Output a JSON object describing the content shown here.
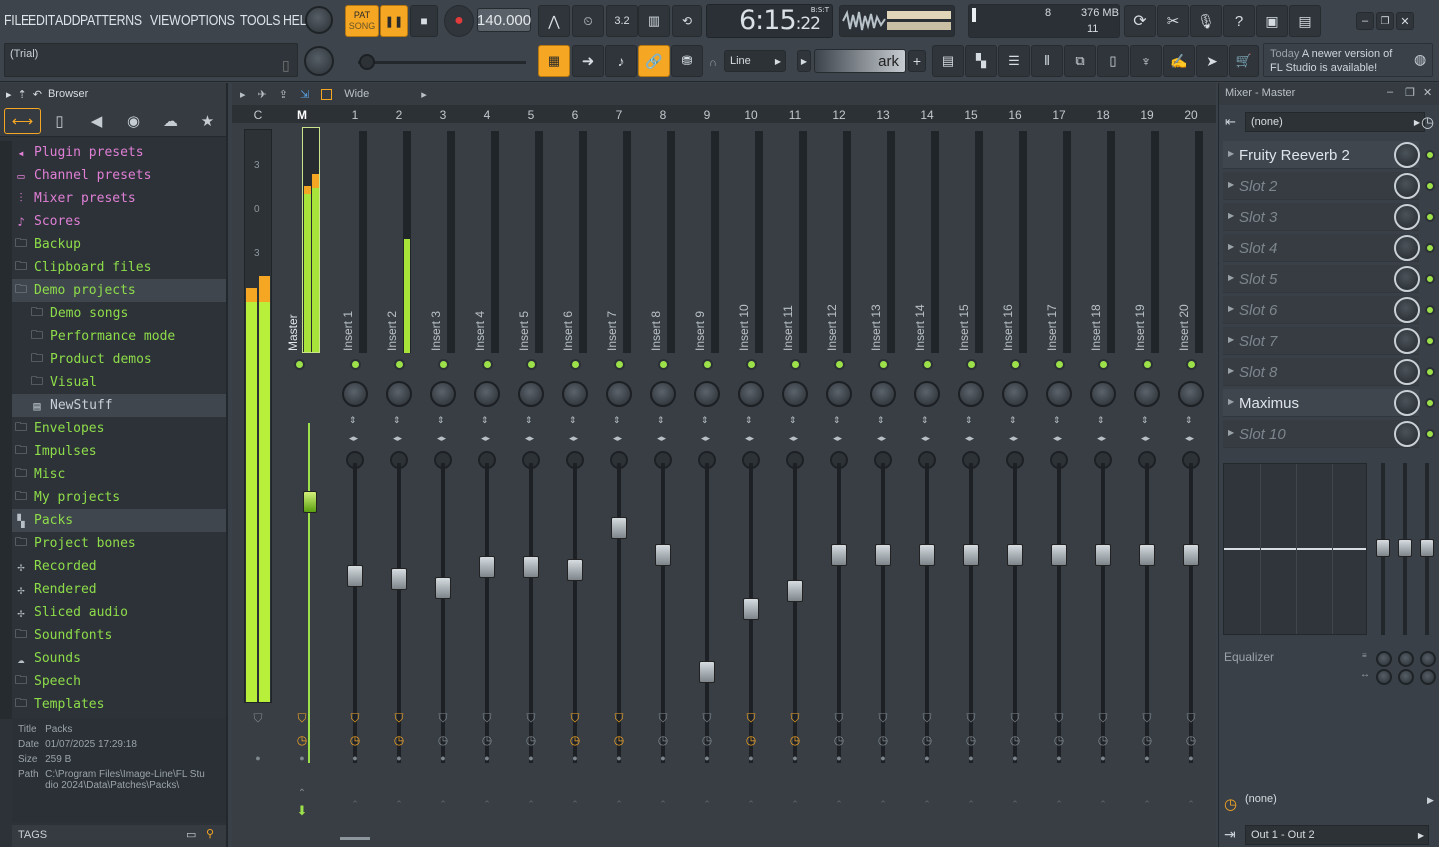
{
  "menu": [
    "FILE",
    "EDIT",
    "ADD",
    "PATTERNS",
    "VIEW",
    "OPTIONS",
    "TOOLS",
    "HELP"
  ],
  "hint": "(Trial)",
  "transport": {
    "pat": "PAT",
    "song": "SONG",
    "tempo": "140.000",
    "time_main": "6:15",
    "time_small": ":22",
    "time_unit": "B:S:T"
  },
  "cpu": {
    "voices": "8",
    "memory": "376 MB",
    "polyphony": "11"
  },
  "snap": "Line",
  "pattern": "ark",
  "news": {
    "line1_when": "Today",
    "line1": "A newer version of",
    "line2": "FL Studio is available!"
  },
  "browser": {
    "title": "Browser",
    "items": [
      {
        "label": "Plugin presets",
        "icon": "plugin-icon",
        "style": "pink"
      },
      {
        "label": "Channel presets",
        "icon": "channel-icon",
        "style": "pink"
      },
      {
        "label": "Mixer presets",
        "icon": "mixer-icon",
        "style": "pink"
      },
      {
        "label": "Scores",
        "icon": "note-icon",
        "style": "pink"
      },
      {
        "label": "Backup",
        "icon": "folder-icon",
        "style": "green"
      },
      {
        "label": "Clipboard files",
        "icon": "folder-icon",
        "style": "green"
      },
      {
        "label": "Demo projects",
        "icon": "folder-icon",
        "style": "green",
        "selected": true
      },
      {
        "label": "Demo songs",
        "icon": "folder-icon",
        "style": "green",
        "indent": 1
      },
      {
        "label": "Performance mode",
        "icon": "folder-icon",
        "style": "green",
        "indent": 1
      },
      {
        "label": "Product demos",
        "icon": "folder-icon",
        "style": "green",
        "indent": 1
      },
      {
        "label": "Visual",
        "icon": "folder-icon",
        "style": "green",
        "indent": 1
      },
      {
        "label": "NewStuff",
        "icon": "file-icon",
        "style": "plain",
        "indent": 1,
        "highlight": true
      },
      {
        "label": "Envelopes",
        "icon": "folder-icon",
        "style": "green"
      },
      {
        "label": "Impulses",
        "icon": "folder-icon",
        "style": "green"
      },
      {
        "label": "Misc",
        "icon": "folder-icon",
        "style": "green"
      },
      {
        "label": "My projects",
        "icon": "folder-icon",
        "style": "green"
      },
      {
        "label": "Packs",
        "icon": "packs-icon",
        "style": "green",
        "selected": true
      },
      {
        "label": "Project bones",
        "icon": "folder-icon",
        "style": "green"
      },
      {
        "label": "Recorded",
        "icon": "wave-icon",
        "style": "green"
      },
      {
        "label": "Rendered",
        "icon": "wave-icon",
        "style": "green"
      },
      {
        "label": "Sliced audio",
        "icon": "wave-icon",
        "style": "green"
      },
      {
        "label": "Soundfonts",
        "icon": "folder-icon",
        "style": "green"
      },
      {
        "label": "Sounds",
        "icon": "cloud-icon",
        "style": "green"
      },
      {
        "label": "Speech",
        "icon": "folder-icon",
        "style": "green"
      },
      {
        "label": "Templates",
        "icon": "folder-icon",
        "style": "green"
      }
    ],
    "info": {
      "title_k": "Title",
      "title_v": "Packs",
      "date_k": "Date",
      "date_v": "01/07/2025 17:29:18",
      "size_k": "Size",
      "size_v": "259 B",
      "path_k": "Path",
      "path_v": "C:\\Program Files\\Image-Line\\FL Studio 2024\\Data\\Patches\\Packs\\"
    },
    "tags": "TAGS"
  },
  "mixer": {
    "mode": "Wide",
    "c": "C",
    "m": "M",
    "master": "Master",
    "meter_marks": [
      "3",
      "0",
      "3"
    ],
    "inserts": [
      {
        "n": "1",
        "name": "Insert 1",
        "fader": 0.62,
        "green": true
      },
      {
        "n": "2",
        "name": "Insert 2",
        "fader": 0.61,
        "green": true,
        "level": 0.52
      },
      {
        "n": "3",
        "name": "Insert 3",
        "fader": 0.58
      },
      {
        "n": "4",
        "name": "Insert 4",
        "fader": 0.65
      },
      {
        "n": "5",
        "name": "Insert 5",
        "fader": 0.65
      },
      {
        "n": "6",
        "name": "Insert 6",
        "fader": 0.64,
        "green": true
      },
      {
        "n": "7",
        "name": "Insert 7",
        "fader": 0.78,
        "green": true
      },
      {
        "n": "8",
        "name": "Insert 8",
        "fader": 0.69
      },
      {
        "n": "9",
        "name": "Insert 9",
        "fader": 0.3
      },
      {
        "n": "10",
        "name": "Insert 10",
        "fader": 0.51,
        "green": true
      },
      {
        "n": "11",
        "name": "Insert 11",
        "fader": 0.57,
        "green": true
      },
      {
        "n": "12",
        "name": "Insert 12",
        "fader": 0.69
      },
      {
        "n": "13",
        "name": "Insert 13",
        "fader": 0.69
      },
      {
        "n": "14",
        "name": "Insert 14",
        "fader": 0.69
      },
      {
        "n": "15",
        "name": "Insert 15",
        "fader": 0.69
      },
      {
        "n": "16",
        "name": "Insert 16",
        "fader": 0.69
      },
      {
        "n": "17",
        "name": "Insert 17",
        "fader": 0.69
      },
      {
        "n": "18",
        "name": "Insert 18",
        "fader": 0.69
      },
      {
        "n": "19",
        "name": "Insert 19",
        "fader": 0.69
      },
      {
        "n": "20",
        "name": "Insert 20",
        "fader": 0.69
      }
    ]
  },
  "master_panel": {
    "title": "Mixer - Master",
    "input": "(none)",
    "slots": [
      "Fruity Reeverb 2",
      "Slot 2",
      "Slot 3",
      "Slot 4",
      "Slot 5",
      "Slot 6",
      "Slot 7",
      "Slot 8",
      "Maximus",
      "Slot 10"
    ],
    "filled": [
      true,
      false,
      false,
      false,
      false,
      false,
      false,
      false,
      true,
      false
    ],
    "eq_label": "Equalizer",
    "send": "(none)",
    "output": "Out 1 - Out 2"
  },
  "colors": {
    "accent": "#f5a623",
    "green": "#9ce04a",
    "bg": "#3a4047"
  }
}
